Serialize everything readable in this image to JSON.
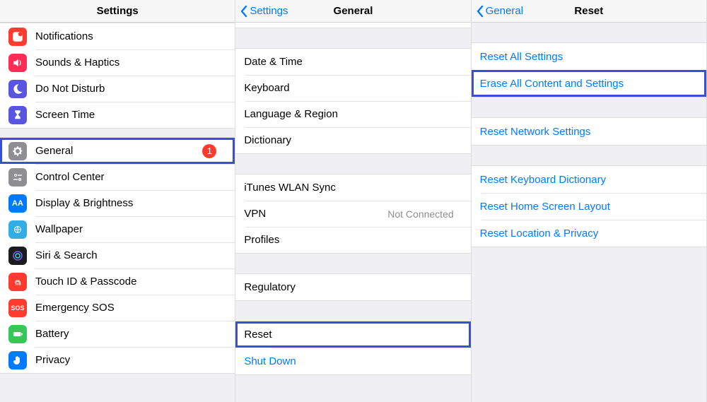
{
  "pane1": {
    "title": "Settings",
    "rows": [
      {
        "id": "notifications",
        "label": "Notifications"
      },
      {
        "id": "sounds",
        "label": "Sounds & Haptics"
      },
      {
        "id": "dnd",
        "label": "Do Not Disturb"
      },
      {
        "id": "screentime",
        "label": "Screen Time"
      },
      {
        "id": "general",
        "label": "General",
        "badge": "1"
      },
      {
        "id": "controlcenter",
        "label": "Control Center"
      },
      {
        "id": "display",
        "label": "Display & Brightness"
      },
      {
        "id": "wallpaper",
        "label": "Wallpaper"
      },
      {
        "id": "siri",
        "label": "Siri & Search"
      },
      {
        "id": "touchid",
        "label": "Touch ID & Passcode"
      },
      {
        "id": "sos",
        "label": "Emergency SOS"
      },
      {
        "id": "battery",
        "label": "Battery"
      },
      {
        "id": "privacy",
        "label": "Privacy"
      }
    ]
  },
  "pane2": {
    "back": "Settings",
    "title": "General",
    "rows": [
      {
        "id": "datetime",
        "label": "Date & Time"
      },
      {
        "id": "keyboard",
        "label": "Keyboard"
      },
      {
        "id": "langregion",
        "label": "Language & Region"
      },
      {
        "id": "dictionary",
        "label": "Dictionary"
      },
      {
        "id": "ituneswlan",
        "label": "iTunes WLAN Sync"
      },
      {
        "id": "vpn",
        "label": "VPN",
        "value": "Not Connected"
      },
      {
        "id": "profiles",
        "label": "Profiles"
      },
      {
        "id": "regulatory",
        "label": "Regulatory"
      },
      {
        "id": "reset",
        "label": "Reset"
      },
      {
        "id": "shutdown",
        "label": "Shut Down"
      }
    ]
  },
  "pane3": {
    "back": "General",
    "title": "Reset",
    "rows": [
      {
        "id": "resetall",
        "label": "Reset All Settings"
      },
      {
        "id": "eraseall",
        "label": "Erase All Content and Settings"
      },
      {
        "id": "resetnet",
        "label": "Reset Network Settings"
      },
      {
        "id": "resetkb",
        "label": "Reset Keyboard Dictionary"
      },
      {
        "id": "resethome",
        "label": "Reset Home Screen Layout"
      },
      {
        "id": "resetloc",
        "label": "Reset Location & Privacy"
      }
    ]
  }
}
